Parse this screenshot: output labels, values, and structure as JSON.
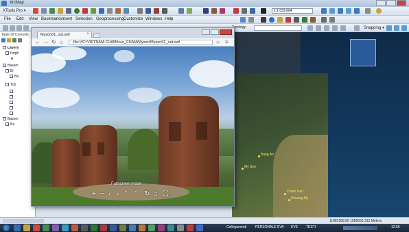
{
  "window": {
    "title": "ArcMap",
    "toolbar1_label": "XTools Pro ▾",
    "scale": "1:1.033.604"
  },
  "menu": [
    "File",
    "Edit",
    "View",
    "Bookmarks",
    "Insert",
    "Selection",
    "Geoprocessing",
    "Customize",
    "Windows",
    "Help"
  ],
  "editor": {
    "topology_label": "Topology:",
    "snapping_label": "Snapping ▾"
  },
  "toc": {
    "title": "Table Of Contents",
    "layers": [
      "Layers",
      "Ivngh",
      "Basem",
      "Bi",
      "Ba",
      "Trip",
      "Basem",
      "Ba"
    ]
  },
  "browser": {
    "tab_title": "Myson01_out.swf",
    "url": "file:///C:/VIETNAM-CHAM/tour_CHAM/Myson/Myson01_out.swf",
    "fullscreen_label": "Fullscreen mode"
  },
  "map_labels": [
    "Bang An",
    "My Son",
    "Cham Dan",
    "Khuong My"
  ],
  "status": {
    "coords": "11981958.95  1586556.313 Meters"
  },
  "taskbar": {
    "items": [
      "Collegamenti",
      "PERSONALE EVA",
      "EVE",
      "TESTI"
    ],
    "clock": "12:56"
  },
  "colors": {
    "map_label": "#f3e65b",
    "taskbar": "#18263a"
  }
}
